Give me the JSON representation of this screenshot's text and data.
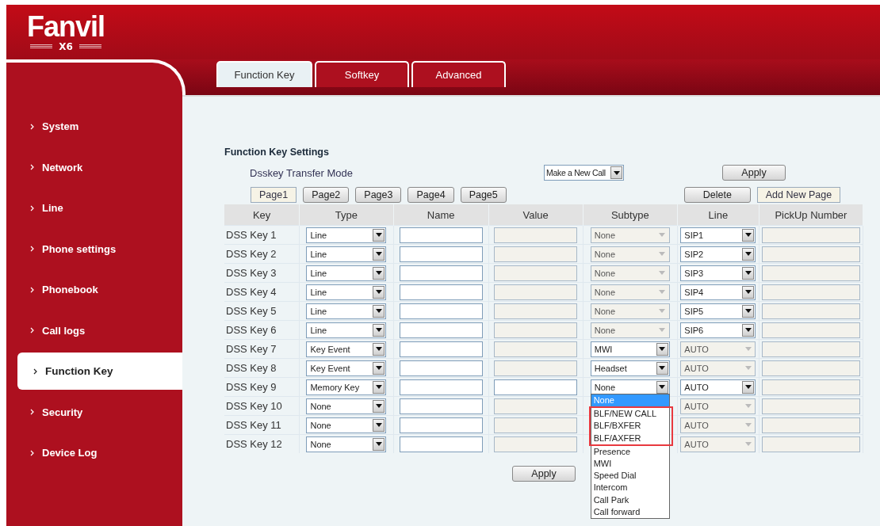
{
  "logo": {
    "brand": "Fanvil",
    "model": "X6"
  },
  "sidebar": {
    "items": [
      {
        "label": "System",
        "selected": false
      },
      {
        "label": "Network",
        "selected": false
      },
      {
        "label": "Line",
        "selected": false
      },
      {
        "label": "Phone settings",
        "selected": false
      },
      {
        "label": "Phonebook",
        "selected": false
      },
      {
        "label": "Call logs",
        "selected": false
      },
      {
        "label": "Function Key",
        "selected": true
      },
      {
        "label": "Security",
        "selected": false
      },
      {
        "label": "Device Log",
        "selected": false
      }
    ]
  },
  "tabs": [
    {
      "label": "Function Key",
      "selected": true
    },
    {
      "label": "Softkey",
      "selected": false
    },
    {
      "label": "Advanced",
      "selected": false
    }
  ],
  "section_title": "Function Key Settings",
  "transfer_mode": {
    "label": "Dsskey Transfer Mode",
    "value": "Make a New Call",
    "apply": "Apply"
  },
  "page_buttons": [
    {
      "label": "Page1",
      "selected": true
    },
    {
      "label": "Page2",
      "selected": false
    },
    {
      "label": "Page3",
      "selected": false
    },
    {
      "label": "Page4",
      "selected": false
    },
    {
      "label": "Page5",
      "selected": false
    }
  ],
  "page_actions": [
    {
      "label": "Delete",
      "kind": "raised"
    },
    {
      "label": "Add New Page",
      "kind": "flat"
    }
  ],
  "table": {
    "columns": [
      "Key",
      "Type",
      "Name",
      "Value",
      "Subtype",
      "Line",
      "PickUp Number"
    ],
    "rows": [
      {
        "key": "DSS Key 1",
        "type": "Line",
        "value_disabled": true,
        "subtype": {
          "value": "None",
          "disabled": true
        },
        "line": {
          "value": "SIP1",
          "disabled": false
        },
        "pickup_disabled": true
      },
      {
        "key": "DSS Key 2",
        "type": "Line",
        "value_disabled": true,
        "subtype": {
          "value": "None",
          "disabled": true
        },
        "line": {
          "value": "SIP2",
          "disabled": false
        },
        "pickup_disabled": true
      },
      {
        "key": "DSS Key 3",
        "type": "Line",
        "value_disabled": true,
        "subtype": {
          "value": "None",
          "disabled": true
        },
        "line": {
          "value": "SIP3",
          "disabled": false
        },
        "pickup_disabled": true
      },
      {
        "key": "DSS Key 4",
        "type": "Line",
        "value_disabled": true,
        "subtype": {
          "value": "None",
          "disabled": true
        },
        "line": {
          "value": "SIP4",
          "disabled": false
        },
        "pickup_disabled": true
      },
      {
        "key": "DSS Key 5",
        "type": "Line",
        "value_disabled": true,
        "subtype": {
          "value": "None",
          "disabled": true
        },
        "line": {
          "value": "SIP5",
          "disabled": false
        },
        "pickup_disabled": true
      },
      {
        "key": "DSS Key 6",
        "type": "Line",
        "value_disabled": true,
        "subtype": {
          "value": "None",
          "disabled": true
        },
        "line": {
          "value": "SIP6",
          "disabled": false
        },
        "pickup_disabled": true
      },
      {
        "key": "DSS Key 7",
        "type": "Key Event",
        "value_disabled": true,
        "subtype": {
          "value": "MWI",
          "disabled": false
        },
        "line": {
          "value": "AUTO",
          "disabled": true
        },
        "pickup_disabled": true
      },
      {
        "key": "DSS Key 8",
        "type": "Key Event",
        "value_disabled": true,
        "subtype": {
          "value": "Headset",
          "disabled": false
        },
        "line": {
          "value": "AUTO",
          "disabled": true
        },
        "pickup_disabled": true
      },
      {
        "key": "DSS Key 9",
        "type": "Memory Key",
        "value_disabled": false,
        "subtype": {
          "value": "None",
          "disabled": false,
          "options": [
            {
              "label": "None",
              "selected": true,
              "highlighted": false
            },
            {
              "label": "BLF/NEW CALL",
              "selected": false,
              "highlighted": true
            },
            {
              "label": "BLF/BXFER",
              "selected": false,
              "highlighted": true
            },
            {
              "label": "BLF/AXFER",
              "selected": false,
              "highlighted": true
            },
            {
              "label": "Presence",
              "selected": false,
              "highlighted": false
            },
            {
              "label": "MWI",
              "selected": false,
              "highlighted": false
            },
            {
              "label": "Speed Dial",
              "selected": false,
              "highlighted": false
            },
            {
              "label": "Intercom",
              "selected": false,
              "highlighted": false
            },
            {
              "label": "Call Park",
              "selected": false,
              "highlighted": false
            },
            {
              "label": "Call forward",
              "selected": false,
              "highlighted": false
            }
          ]
        },
        "line": {
          "value": "AUTO",
          "disabled": false
        },
        "pickup_disabled": true
      },
      {
        "key": "DSS Key 10",
        "type": "None",
        "value_disabled": true,
        "line": {
          "value": "AUTO",
          "disabled": true
        },
        "pickup_disabled": true
      },
      {
        "key": "DSS Key 11",
        "type": "None",
        "value_disabled": true,
        "line": {
          "value": "AUTO",
          "disabled": true
        },
        "pickup_disabled": true
      },
      {
        "key": "DSS Key 12",
        "type": "None",
        "value_disabled": true,
        "line": {
          "value": "AUTO",
          "disabled": true
        },
        "pickup_disabled": true
      }
    ]
  },
  "apply_button": "Apply"
}
